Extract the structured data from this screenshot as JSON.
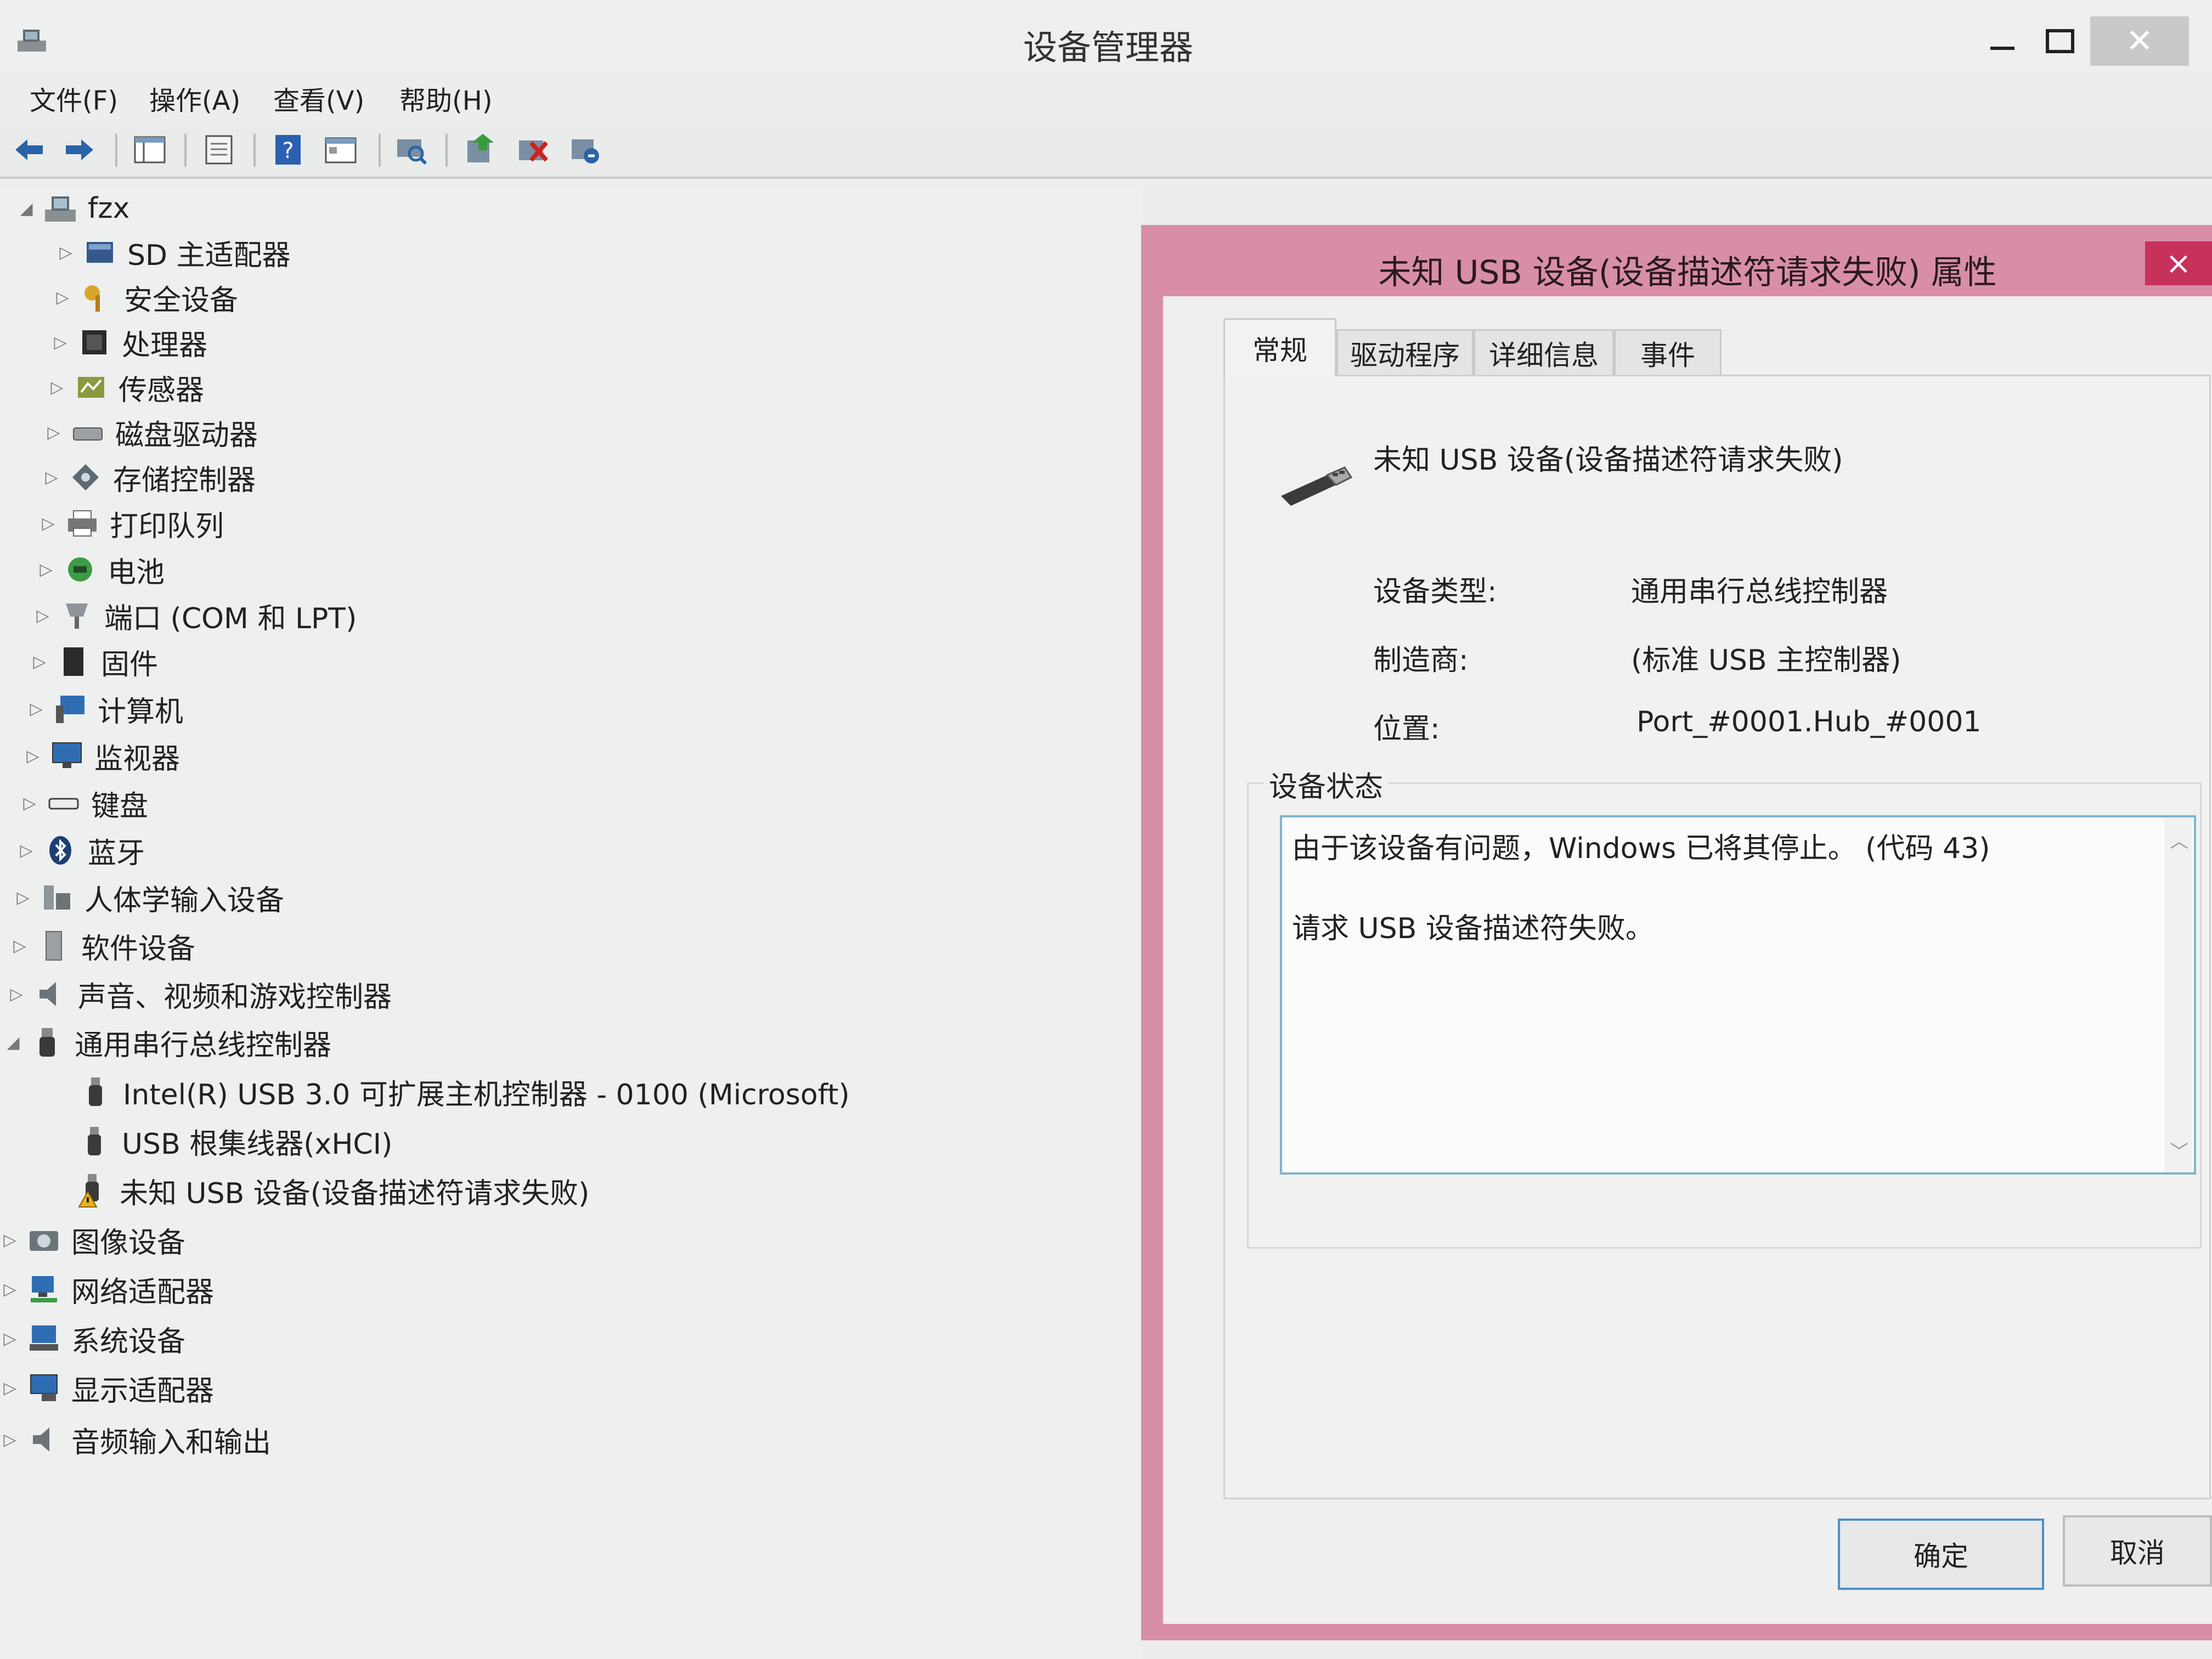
{
  "window": {
    "title": "设备管理器"
  },
  "menu": [
    "文件(F)",
    "操作(A)",
    "查看(V)",
    "帮助(H)"
  ],
  "toolbar_icons": [
    "back-arrow-icon",
    "forward-arrow-icon",
    "console-tree-icon",
    "properties-page-icon",
    "help-icon",
    "view-icon",
    "scan-hardware-icon",
    "update-driver-icon",
    "uninstall-device-icon",
    "disable-device-icon"
  ],
  "tree": {
    "root": "fzx",
    "items": [
      "SD 主适配器",
      "安全设备",
      "处理器",
      "传感器",
      "磁盘驱动器",
      "存储控制器",
      "打印队列",
      "电池",
      "端口 (COM 和 LPT)",
      "固件",
      "计算机",
      "监视器",
      "键盘",
      "蓝牙",
      "人体学输入设备",
      "软件设备",
      "声音、视频和游戏控制器",
      "通用串行总线控制器"
    ],
    "usb_children": [
      "Intel(R) USB 3.0 可扩展主机控制器 - 0100 (Microsoft)",
      "USB 根集线器(xHCI)",
      "未知 USB 设备(设备描述符请求失败)"
    ],
    "after": [
      "图像设备",
      "网络适配器",
      "系统设备",
      "显示适配器",
      "音频输入和输出"
    ]
  },
  "dialog": {
    "title": "未知 USB 设备(设备描述符请求失败) 属性",
    "close": "×",
    "tabs": [
      "常规",
      "驱动程序",
      "详细信息",
      "事件"
    ],
    "device_name": "未知 USB 设备(设备描述符请求失败)",
    "props": {
      "type_label": "设备类型:",
      "type_value": "通用串行总线控制器",
      "mfr_label": "制造商:",
      "mfr_value": "(标准 USB 主控制器)",
      "loc_label": "位置:",
      "loc_value": "Port_#0001.Hub_#0001"
    },
    "status_group": "设备状态",
    "status_line1": "由于该设备有问题，Windows 已将其停止。 (代码 43)",
    "status_line2": "请求 USB 设备描述符失败。",
    "ok": "确定",
    "cancel": "取消"
  },
  "colors": {
    "dialog_frame": "#d98ea8",
    "close_red": "#c7325d",
    "focus_blue": "#4d8fc9"
  }
}
